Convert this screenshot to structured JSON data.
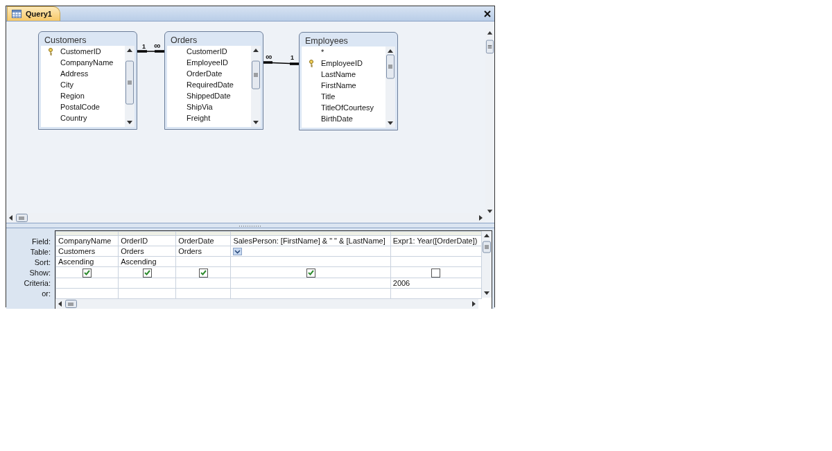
{
  "window": {
    "title": "Query1"
  },
  "tables": [
    {
      "name": "Customers",
      "fields": [
        {
          "name": "CustomerID",
          "key": true
        },
        {
          "name": "CompanyName",
          "key": false
        },
        {
          "name": "Address",
          "key": false
        },
        {
          "name": "City",
          "key": false
        },
        {
          "name": "Region",
          "key": false
        },
        {
          "name": "PostalCode",
          "key": false
        },
        {
          "name": "Country",
          "key": false
        }
      ]
    },
    {
      "name": "Orders",
      "fields": [
        {
          "name": "CustomerID",
          "key": false
        },
        {
          "name": "EmployeeID",
          "key": false
        },
        {
          "name": "OrderDate",
          "key": false
        },
        {
          "name": "RequiredDate",
          "key": false
        },
        {
          "name": "ShippedDate",
          "key": false
        },
        {
          "name": "ShipVia",
          "key": false
        },
        {
          "name": "Freight",
          "key": false
        }
      ]
    },
    {
      "name": "Employees",
      "fields": [
        {
          "name": "*",
          "key": false
        },
        {
          "name": "EmployeeID",
          "key": true
        },
        {
          "name": "LastName",
          "key": false
        },
        {
          "name": "FirstName",
          "key": false
        },
        {
          "name": "Title",
          "key": false
        },
        {
          "name": "TitleOfCourtesy",
          "key": false
        },
        {
          "name": "BirthDate",
          "key": false
        }
      ]
    }
  ],
  "relationships": [
    {
      "from_label": "1",
      "to_label": "∞"
    },
    {
      "from_label": "∞",
      "to_label": "1"
    }
  ],
  "grid": {
    "row_labels": [
      "Field:",
      "Table:",
      "Sort:",
      "Show:",
      "Criteria:",
      "or:"
    ],
    "columns": [
      {
        "field": "CompanyName",
        "table": "Customers",
        "sort": "Ascending",
        "show": true,
        "active": false
      },
      {
        "field": "OrderID",
        "table": "Orders",
        "sort": "Ascending",
        "show": true,
        "active": false
      },
      {
        "field": "OrderDate",
        "table": "Orders",
        "show": true,
        "active": false
      },
      {
        "field": "SalesPerson: [FirstName] & \" \" & [LastName]",
        "show": true,
        "active": true
      },
      {
        "field": "Expr1: Year([OrderDate])",
        "show": false,
        "criteria": "2006",
        "active": false
      }
    ]
  }
}
